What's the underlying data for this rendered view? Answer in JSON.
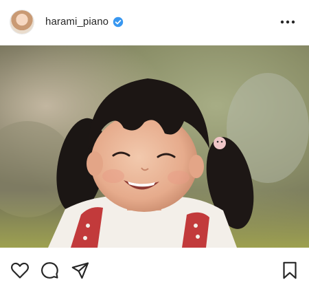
{
  "post": {
    "username": "harami_piano",
    "verified": true,
    "header_icons": {
      "avatar": "profile-avatar",
      "verified": "verified-badge-icon",
      "more": "more-options-icon"
    },
    "photo_subject": "child-portrait-photo"
  },
  "actions": {
    "like": "heart-icon",
    "comment": "comment-icon",
    "share": "send-icon",
    "save": "bookmark-icon"
  },
  "colors": {
    "text": "#262626",
    "verified_blue": "#3897f0",
    "background": "#ffffff"
  }
}
